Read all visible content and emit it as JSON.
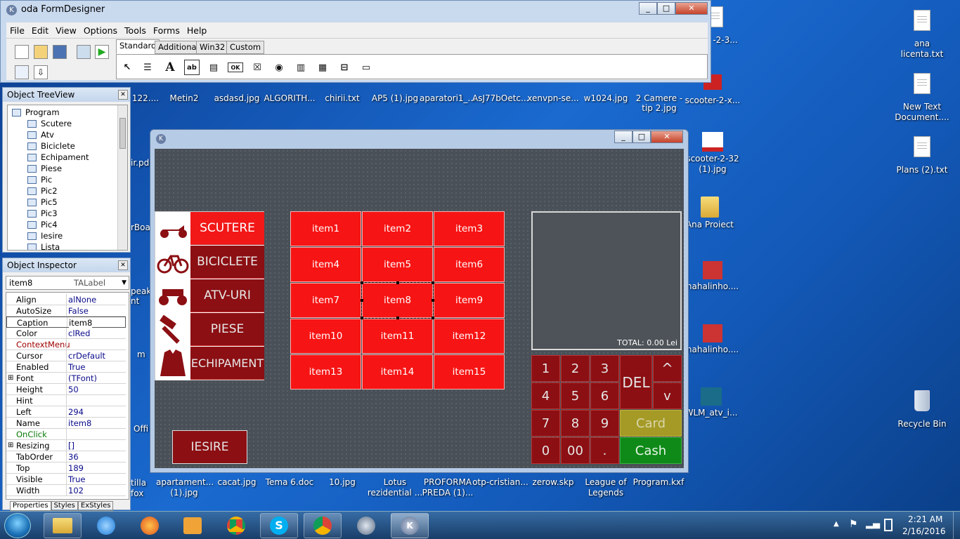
{
  "colors": {
    "form_bg": "#4a5057",
    "item_red": "#f71414",
    "dark_red": "#8b0f13",
    "card": "#a59a26",
    "cash": "#0f8a18",
    "desktop": "#1a6ad0"
  },
  "designer": {
    "title": "oda FormDesigner",
    "menu": [
      "File",
      "Edit",
      "View",
      "Options",
      "Tools",
      "Forms",
      "Help"
    ],
    "tabs": [
      "Standard",
      "Additional",
      "Win32",
      "Custom"
    ]
  },
  "tree": {
    "title": "Object TreeView",
    "root": "Program",
    "items": [
      "Scutere",
      "Atv",
      "Biciclete",
      "Echipament",
      "Piese",
      "Pic",
      "Pic2",
      "Pic5",
      "Pic3",
      "Pic4",
      "Iesire",
      "Lista"
    ]
  },
  "inspector": {
    "title": "Object Inspector",
    "selected_name": "item8",
    "selected_type": "TALabel",
    "props": [
      {
        "name": "Align",
        "value": "alNone"
      },
      {
        "name": "AutoSize",
        "value": "False"
      },
      {
        "name": "Caption",
        "value": "item8"
      },
      {
        "name": "Color",
        "value": "clRed"
      },
      {
        "name": "ContextMenu",
        "value": ""
      },
      {
        "name": "Cursor",
        "value": "crDefault"
      },
      {
        "name": "Enabled",
        "value": "True"
      },
      {
        "name": "Font",
        "value": "(TFont)"
      },
      {
        "name": "Height",
        "value": "50"
      },
      {
        "name": "Hint",
        "value": ""
      },
      {
        "name": "Left",
        "value": "294"
      },
      {
        "name": "Name",
        "value": "item8"
      },
      {
        "name": "OnClick",
        "value": ""
      },
      {
        "name": "Resizing",
        "value": "[]"
      },
      {
        "name": "TabOrder",
        "value": "36"
      },
      {
        "name": "Top",
        "value": "189"
      },
      {
        "name": "Visible",
        "value": "True"
      },
      {
        "name": "Width",
        "value": "102"
      }
    ],
    "bottom_tabs": [
      "Properties",
      "Styles",
      "ExStyles"
    ]
  },
  "form": {
    "categories": [
      "SCUTERE",
      "BICICLETE",
      "ATV-URI",
      "PIESE",
      "ECHIPAMENT"
    ],
    "items": [
      "item1",
      "item2",
      "item3",
      "item4",
      "item5",
      "item6",
      "item7",
      "item8",
      "item9",
      "item10",
      "item11",
      "item12",
      "item13",
      "item14",
      "item15"
    ],
    "total": "TOTAL: 0.00 Lei",
    "exit": "IESIRE",
    "keypad": [
      "1",
      "2",
      "3",
      "4",
      "5",
      "6",
      "7",
      "8",
      "9",
      "0",
      "00",
      "."
    ],
    "del": "DEL",
    "up": "^",
    "down": "v",
    "card": "Card",
    "cash": "Cash"
  },
  "desktop": {
    "right_icons": [
      "ana licenta.txt",
      "New Text Document....",
      "Plans (2).txt",
      "Recycle Bin"
    ],
    "col2_icons": [
      "-2-3...",
      "scooter-2-x...",
      "scooter-2-32 (1).jpg",
      "Ana Proiect",
      "nahalinho....",
      "nahalinho....",
      "WLM_atv_i..."
    ],
    "top_row": [
      "122....",
      "Metin2",
      "asdasd.jpg",
      "ALGORITH...",
      "chirii.txt",
      "AP5 (1).jpg",
      "aparatori1_...",
      "AsJ77bOetc...",
      "xenvpn-se...",
      "w1024.jpg",
      "2 Camere - tip 2.jpg"
    ],
    "left_partial": [
      "ir.pd",
      "rBoa",
      "peak nt",
      "m",
      "Offi",
      "tilla fox"
    ],
    "bottom_row": [
      "apartament... (1).jpg",
      "cacat.jpg",
      "Tema 6.doc",
      "10.jpg",
      "Lotus rezidential ...",
      "PROFORMA PREDA (1)...",
      "otp-cristian...",
      "zerow.skp",
      "League of Legends",
      "Program.kxf"
    ]
  },
  "clock": {
    "time": "2:21 AM",
    "date": "2/16/2016"
  }
}
